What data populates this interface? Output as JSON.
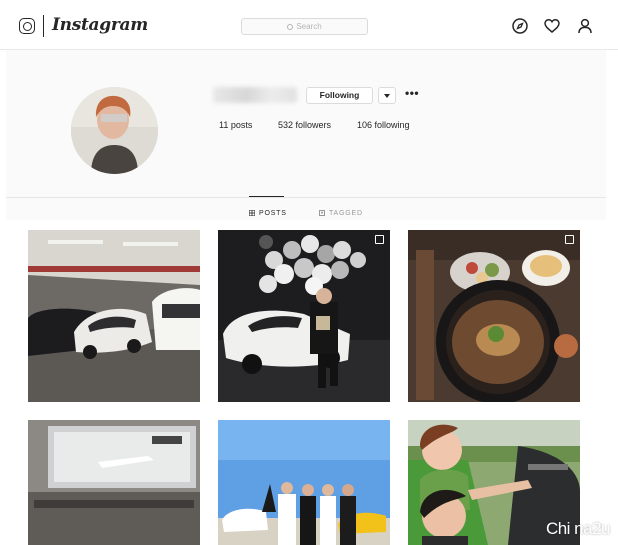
{
  "app": {
    "wordmark": "Instagram"
  },
  "search": {
    "placeholder": "Search"
  },
  "profile": {
    "follow_button": "Following",
    "more": "•••",
    "stats": {
      "posts": "11 posts",
      "followers": "532 followers",
      "following": "106 following"
    }
  },
  "tabs": [
    {
      "label": "POSTS",
      "icon": "grid-icon",
      "active": true
    },
    {
      "label": "TAGGED",
      "icon": "tag-icon",
      "active": false
    }
  ],
  "watermark": "Chi na2u",
  "icons": [
    "instagram-logo-icon",
    "search-icon",
    "compass-icon",
    "heart-icon",
    "user-icon",
    "chevron-down-icon",
    "multi-photo-icon"
  ]
}
